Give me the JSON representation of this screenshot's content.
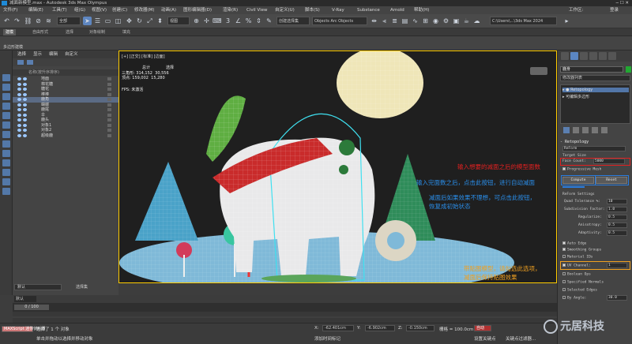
{
  "window": {
    "title": "减面新模型.max - Autodesk 3ds Max Olympus"
  },
  "menu": {
    "items": [
      "文件(F)",
      "编辑(E)",
      "工具(T)",
      "组(G)",
      "视图(V)",
      "创建(C)",
      "修改器(M)",
      "动画(A)",
      "图形编辑器(D)",
      "渲染(R)",
      "Civil View",
      "自定义(U)",
      "脚本(S)",
      "V-Ray",
      "Substance",
      "Arnold",
      "帮助(H)"
    ],
    "workspace": "工作区:",
    "user": "登录"
  },
  "toolbar": {
    "filter_combo": "全部",
    "view_combo": "视图",
    "selection_set": "创建选择集",
    "objects_combo": "Objects Arc Objects",
    "path_combo": "C:\\Users\\...\\3ds Max 2024"
  },
  "ribbon": {
    "tabs": [
      "建模",
      "自由形式",
      "选择",
      "对象绘制",
      "填充"
    ],
    "title": "多边形建模"
  },
  "explorer": {
    "menu": [
      "选择",
      "显示",
      "编辑",
      "自定义"
    ],
    "column_header": "名称(按升序排序)",
    "rows": [
      "地面",
      "棉花糖",
      "糖花",
      "棒棒",
      "鹿角",
      "蝴蝶",
      "鹿尾",
      "伞",
      "鹿头",
      "对象1",
      "对象2",
      "超级鹿"
    ],
    "selected_index": 4,
    "layer": "默认",
    "layer_combo": "选择集"
  },
  "viewport": {
    "label": "[+] [正交] [标准] [边面]",
    "stats": {
      "h1": "总计",
      "h2": "选择",
      "row1_label": "三角形:",
      "row1_a": "314,152",
      "row1_b": "30,556",
      "row2_label": "顶点:",
      "row2_a": "159,002",
      "row2_b": "15,280"
    },
    "fps_label": "FPS:",
    "fps_value": "未激活",
    "note1": "输入想要的减面之后的模型面数",
    "note2": "输入完面数之后，点击此按钮，进行自动减面",
    "note3a": "减面后如果效果不理想，可点击此按钮，",
    "note3b": "恢复成初始状态",
    "note4a": "带贴图模型，请勾选此选项，",
    "note4b": "减面后保持贴图效果",
    "colors": {
      "red": "#e02020",
      "blue": "#2a8de8",
      "orange": "#f0a020"
    }
  },
  "command_panel": {
    "object_name": "鹿身",
    "modifier_list": "修改器列表",
    "stack": [
      "Retopology",
      "可编辑多边形"
    ],
    "rollup": "Retopology",
    "mode": "ReForm",
    "target_size": "Target Size",
    "face_count_label": "Face Count:",
    "face_count_value": "5000",
    "progressive_mesh": "Progressive Mesh",
    "compute": "Compute",
    "reset": "Reset",
    "reform_settings": "ReForm Settings",
    "params": [
      {
        "label": "Quad Tolerance %:",
        "value": "10"
      },
      {
        "label": "Subdivision Factor:",
        "value": "1.0"
      },
      {
        "label": "Regularize:",
        "value": "0.5"
      },
      {
        "label": "Anisotropy:",
        "value": "0.5"
      },
      {
        "label": "Adaptivity:",
        "value": "0.5"
      }
    ],
    "auto_edge": "Auto Edge",
    "smoothing_groups": "Smoothing Groups",
    "material_ids": "Material IDs",
    "uv_channel_label": "UV Channel:",
    "uv_channel_value": "1",
    "boolean_ops": "Boolean Ops",
    "specified_normals": "Specified Normals",
    "selected_edges": "Selected Edges",
    "by_angle_label": "By Angle:",
    "by_angle_value": "30.0"
  },
  "timeline": {
    "frame": "0 / 100"
  },
  "status": {
    "maxscript": "MAXScript 迷你侦听器",
    "selected": "选择了 1 个 对象",
    "prompt": "单击并拖动以选择并移动对象",
    "x_label": "X:",
    "x": "-62.401cm",
    "y_label": "Y:",
    "y": "-6.902cm",
    "z_label": "Z:",
    "z": "-0.150cm",
    "grid": "栅格 = 100.0cm",
    "add_time_tag": "添加时间标记",
    "auto_key": "自动",
    "set_key": "设置关键点",
    "key_filter": "关键点过滤器..."
  },
  "watermark": "元居科技"
}
